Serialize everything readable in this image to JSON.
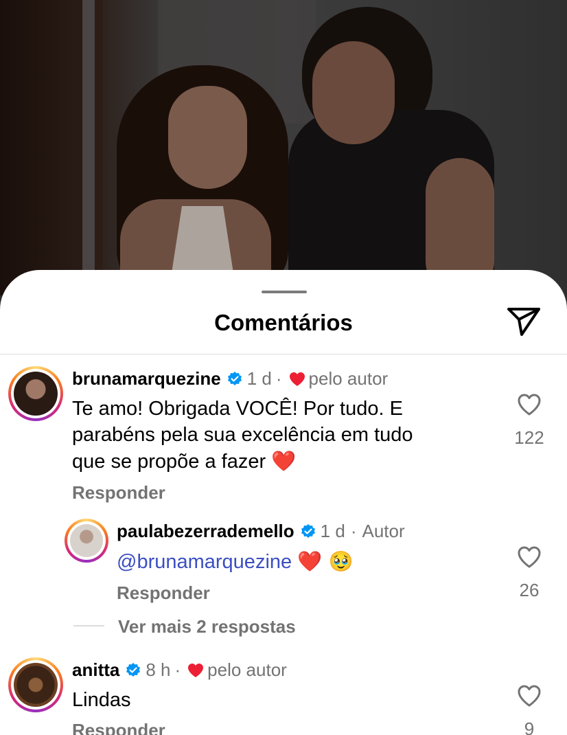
{
  "header": {
    "title": "Comentários",
    "share_icon": "send-icon"
  },
  "comments": [
    {
      "username": "brunamarquezine",
      "time": "1 d",
      "separator": "·",
      "badge": "pelo autor",
      "text_lines": [
        "Te amo! Obrigada VOCÊ! Por tudo. E",
        "parabéns pela sua excelência em tudo",
        "que se propõe a fazer"
      ],
      "emoji": "❤️",
      "reply_label": "Responder",
      "likes": "122"
    },
    {
      "username": "paulabezerrademello",
      "time": "1 d",
      "separator": "·",
      "badge": "Autor",
      "mention": "@brunamarquezine",
      "emoji": "❤️ 🥹",
      "reply_label": "Responder",
      "likes": "26",
      "more_replies": "Ver mais 2 respostas"
    },
    {
      "username": "anitta",
      "time": "8 h",
      "separator": "·",
      "badge": "pelo autor",
      "text": "Lindas",
      "reply_label": "Responder",
      "likes": "9"
    }
  ],
  "colors": {
    "verified_blue": "#0095f6",
    "heart_red": "#ed1f35",
    "mention_blue": "#3b4ec2",
    "muted_text": "#737373"
  }
}
